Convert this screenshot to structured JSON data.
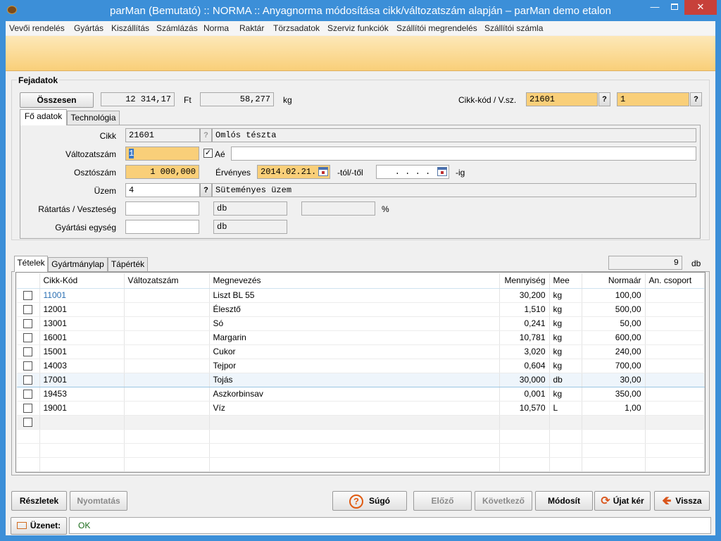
{
  "window": {
    "title": "parMan (Bemutató) :: NORMA :: Anyagnorma módosítása cikk/változatszám alapján  –  parMan demo etalon"
  },
  "menu": [
    "Vevői rendelés",
    "Gyártás",
    "Kiszállítás",
    "Számlázás",
    "Norma",
    "Raktár",
    "Törzsadatok",
    "Szerviz funkciók",
    "Szállítói megrendelés",
    "Szállítói számla"
  ],
  "header": {
    "group_title": "Fejadatok",
    "total_button": "Összesen",
    "total_value": "12 314,17",
    "total_unit": "Ft",
    "weight_value": "58,277",
    "weight_unit": "kg",
    "code_label": "Cikk-kód / V.sz.",
    "code_value": "21601",
    "version_value": "1",
    "q_label": "?"
  },
  "top_tabs": [
    "Fő adatok",
    "Technológia"
  ],
  "main": {
    "cikk_label": "Cikk",
    "cikk_code": "21601",
    "cikk_name": "Omlós tészta",
    "valtozat_label": "Változatszám",
    "valtozat_value": "1",
    "ae_label": "Aé",
    "ae_value": "",
    "oszto_label": "Osztószám",
    "oszto_value": "1 000,000",
    "ervenyes_label": "Érvényes",
    "ervenyes_from": "2014.02.21.",
    "tol_label": "-tól/-től",
    "ervenyes_to": ". . . .",
    "ig_label": "-ig",
    "uzem_label": "Üzem",
    "uzem_code": "4",
    "uzem_name": "Süteményes üzem",
    "ratartas_label": "Rátartás / Veszteség",
    "ratartas_value": "",
    "ratartas_unit": "db",
    "veszteseg_value": "",
    "percent": "%",
    "gyartasi_label": "Gyártási egység",
    "gyartasi_value": "",
    "gyartasi_unit": "db"
  },
  "bottom_tabs": [
    "Tételek",
    "Gyártmánylap",
    "Tápérték"
  ],
  "items_count": "9",
  "items_unit": "db",
  "table": {
    "columns": [
      "",
      "Cikk-Kód",
      "Változatszám",
      "Megnevezés",
      "Mennyiség",
      "Mee",
      "Normaár",
      "An. csoport"
    ],
    "rows": [
      [
        "11001",
        "",
        "Liszt BL 55",
        "30,200",
        "kg",
        "100,00",
        ""
      ],
      [
        "12001",
        "",
        "Élesztő",
        "1,510",
        "kg",
        "500,00",
        ""
      ],
      [
        "13001",
        "",
        "Só",
        "0,241",
        "kg",
        "50,00",
        ""
      ],
      [
        "16001",
        "",
        "Margarin",
        "10,781",
        "kg",
        "600,00",
        ""
      ],
      [
        "15001",
        "",
        "Cukor",
        "3,020",
        "kg",
        "240,00",
        ""
      ],
      [
        "14003",
        "",
        "Tejpor",
        "0,604",
        "kg",
        "700,00",
        ""
      ],
      [
        "17001",
        "",
        "Tojás",
        "30,000",
        "db",
        "30,00",
        ""
      ],
      [
        "19453",
        "",
        "Aszkorbinsav",
        "0,001",
        "kg",
        "350,00",
        ""
      ],
      [
        "19001",
        "",
        "Víz",
        "10,570",
        "L",
        "1,00",
        ""
      ]
    ],
    "selected_row": 6,
    "first_code_color": "#2a6fb3"
  },
  "buttons": {
    "reszletek": "Részletek",
    "nyomtatas": "Nyomtatás",
    "sugo": "Súgó",
    "elozo": "Előző",
    "kovetkezo": "Következő",
    "modosit": "Módosít",
    "ujat_ker": "Újat kér",
    "vissza": "Vissza"
  },
  "status": {
    "label": "Üzenet:",
    "message": "OK"
  },
  "colors": {
    "title_bar": "#3c8fd8",
    "accent_orange": "#f9cf79",
    "ok_text": "#1a6b1a"
  }
}
